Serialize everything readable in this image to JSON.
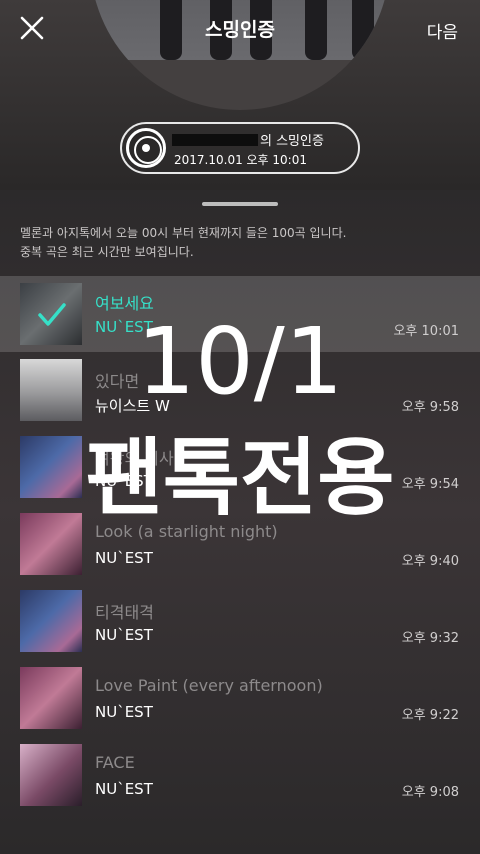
{
  "header": {
    "title": "스밍인증",
    "next_label": "다음"
  },
  "certificate": {
    "title_suffix": "의 스밍인증",
    "datetime": "2017.10.01 오후 10:01"
  },
  "info_text": {
    "line1": "멜론과 아지톡에서 오늘 00시 부터 현재까지 들은 100곡 입니다.",
    "line2": "중복 곡은 최근 시간만 보여집니다."
  },
  "songs": [
    {
      "title": "여보세요",
      "artist": "NU`EST",
      "time": "오후 10:01",
      "selected": true
    },
    {
      "title": "있다면",
      "artist": "뉴이스트 W",
      "time": "오후 9:58",
      "selected": false
    },
    {
      "title": "여왕의 기사",
      "artist": "NU`EST",
      "time": "오후 9:54",
      "selected": false
    },
    {
      "title": "Look (a starlight night)",
      "artist": "NU`EST",
      "time": "오후 9:40",
      "selected": false
    },
    {
      "title": "티격태격",
      "artist": "NU`EST",
      "time": "오후 9:32",
      "selected": false
    },
    {
      "title": "Love Paint (every afternoon)",
      "artist": "NU`EST",
      "time": "오후 9:22",
      "selected": false
    },
    {
      "title": "FACE",
      "artist": "NU`EST",
      "time": "오후 9:08",
      "selected": false
    }
  ],
  "overlay": {
    "line1": "10/1",
    "line2": "팬톡전용"
  },
  "colors": {
    "accent": "#36e0c8",
    "background": "#2e2b2c"
  }
}
